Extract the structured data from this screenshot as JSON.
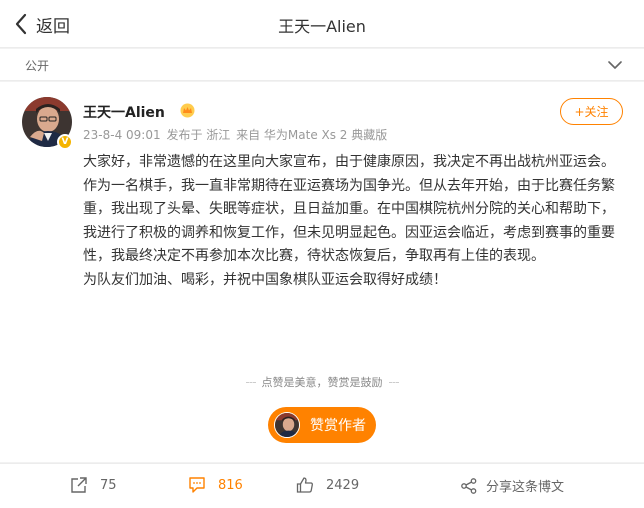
{
  "topbar": {
    "back_label": "返回",
    "title": "王天一Alien"
  },
  "visibility": {
    "label": "公开"
  },
  "post": {
    "author": "王天一Alien",
    "time": "23-8-4 09:01",
    "published_from": "发布于 浙江",
    "source": "来自 华为Mate Xs 2 典藏版",
    "follow_label": "+关注",
    "paragraphs": [
      "大家好，非常遗憾的在这里向大家宣布，由于健康原因，我决定不再出战杭州亚运会。",
      "作为一名棋手，我一直非常期待在亚运赛场为国争光。但从去年开始，由于比赛任务繁重，我出现了头晕、失眠等症状，且日益加重。在中国棋院杭州分院的关心和帮助下，我进行了积极的调养和恢复工作，但未见明显起色。因亚运会临近，考虑到赛事的重要性，我最终决定不再参加本次比赛，待状态恢复后，争取再有上佳的表现。",
      "为队友们加油、喝彩，并祝中国象棋队亚运会取得好成绩！"
    ]
  },
  "tip": {
    "slogan": "点赞是美意，赞赏是鼓励",
    "button_label": "赞赏作者"
  },
  "actions": {
    "repost_count": "75",
    "comment_count": "816",
    "like_count": "2429",
    "share_label": "分享这条博文"
  },
  "colors": {
    "accent": "#ff8200",
    "badge": "#f5b400"
  }
}
